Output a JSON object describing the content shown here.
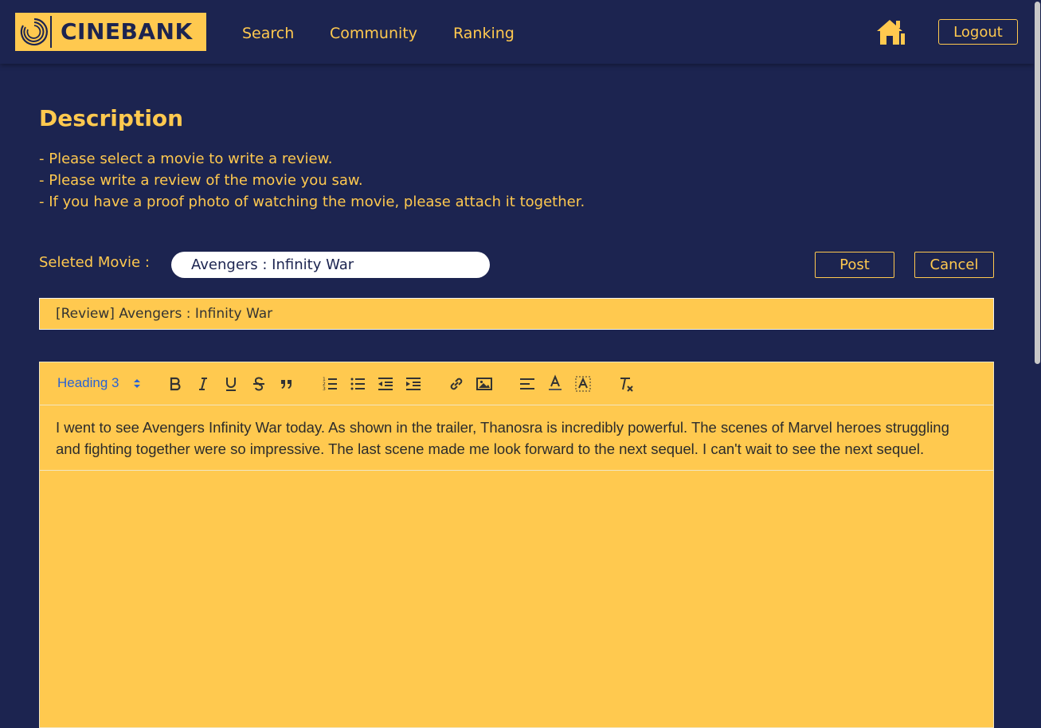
{
  "nav": {
    "logo_text": "CINEBANK",
    "links": [
      "Search",
      "Community",
      "Ranking"
    ],
    "logout_label": "Logout"
  },
  "description": {
    "title": "Description",
    "lines": [
      "- Please select a movie to write a review.",
      "- Please write a review of the movie you saw.",
      "- If you have a proof photo of watching the movie, please attach it together."
    ]
  },
  "form": {
    "movie_label": "Seleted Movie :",
    "movie_value": "Avengers : Infinity War",
    "post_label": "Post",
    "cancel_label": "Cancel",
    "title_value": "[Review] Avengers : Infinity War"
  },
  "editor": {
    "heading_select": "Heading 3",
    "toolbar_icons": [
      "bold-icon",
      "italic-icon",
      "underline-icon",
      "strikethrough-icon",
      "blockquote-icon",
      "ordered-list-icon",
      "bullet-list-icon",
      "outdent-icon",
      "indent-icon",
      "link-icon",
      "image-icon",
      "align-left-icon",
      "text-color-icon",
      "background-color-icon",
      "clear-format-icon"
    ],
    "content": "I went to see Avengers Infinity War today. As shown in the trailer, Thanosra is incredibly powerful. The scenes of Marvel heroes struggling and fighting together were so impressive. The last scene made me look forward to the next sequel. I can't wait to see the next sequel."
  },
  "colors": {
    "background": "#1c2450",
    "accent": "#ffc94f",
    "link_blue": "#2a63d4"
  }
}
